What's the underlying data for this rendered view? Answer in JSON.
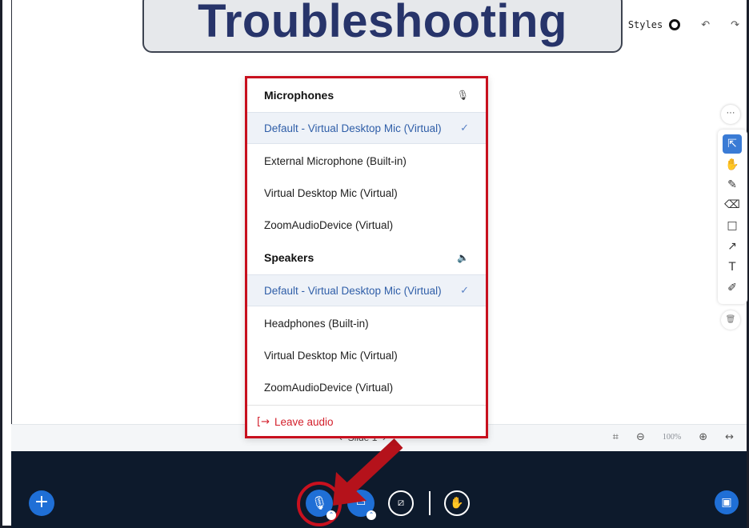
{
  "banner": {
    "title": "Troubleshooting"
  },
  "top_toolbar": {
    "styles_label": "Styles",
    "undo_glyph": "↶",
    "redo_glyph": "↷"
  },
  "right_toolbar": {
    "more_glyph": "···",
    "tools": [
      {
        "name": "select",
        "glyph": "⇱"
      },
      {
        "name": "pan",
        "glyph": "✋"
      },
      {
        "name": "pencil",
        "glyph": "✎"
      },
      {
        "name": "eraser",
        "glyph": "⌫"
      },
      {
        "name": "rectangle",
        "glyph": "□"
      },
      {
        "name": "arrow",
        "glyph": "↗"
      },
      {
        "name": "text",
        "glyph": "T"
      },
      {
        "name": "note",
        "glyph": "✐"
      }
    ],
    "trash_glyph": "🗑"
  },
  "slide_strip": {
    "slide_label": "Slide 1",
    "zoom": "100%",
    "prev_glyph": "‹",
    "next_glyph": "›"
  },
  "audio_menu": {
    "microphones": {
      "header": "Microphones",
      "icon": "mic-icon",
      "options": [
        {
          "label": "Default - Virtual Desktop Mic (Virtual)",
          "selected": true
        },
        {
          "label": "External Microphone (Built-in)",
          "selected": false
        },
        {
          "label": "Virtual Desktop Mic (Virtual)",
          "selected": false
        },
        {
          "label": "ZoomAudioDevice (Virtual)",
          "selected": false
        }
      ]
    },
    "speakers": {
      "header": "Speakers",
      "icon": "speaker-icon",
      "options": [
        {
          "label": "Default - Virtual Desktop Mic (Virtual)",
          "selected": true
        },
        {
          "label": "Headphones (Built-in)",
          "selected": false
        },
        {
          "label": "Virtual Desktop Mic (Virtual)",
          "selected": false
        },
        {
          "label": "ZoomAudioDevice (Virtual)",
          "selected": false
        }
      ]
    },
    "leave_label": "Leave audio"
  },
  "colors": {
    "accent_blue": "#1f6fd6",
    "highlight_red": "#c8101e",
    "bottom_bar": "#0d1a2c",
    "selected_text": "#2f5ea8",
    "banner_text": "#27346a"
  }
}
